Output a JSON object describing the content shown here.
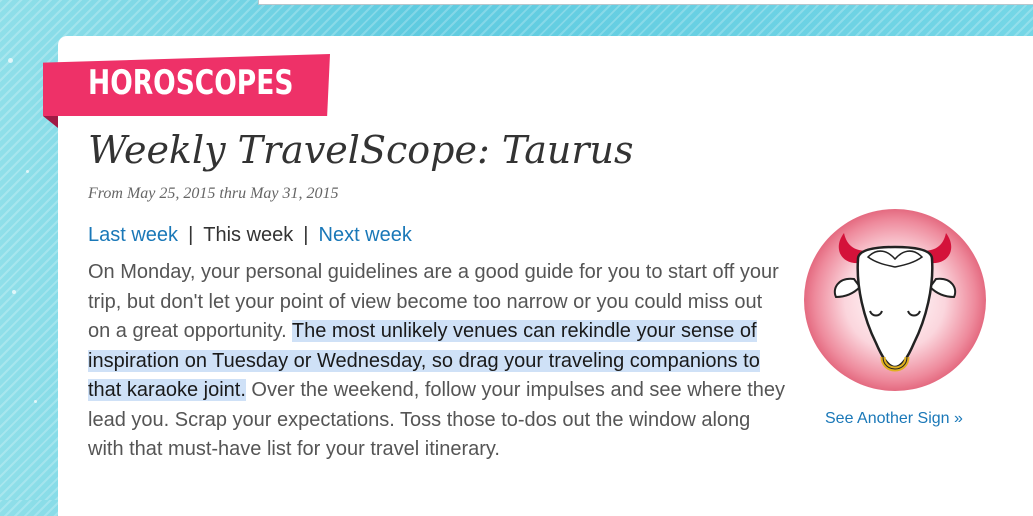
{
  "section": {
    "label": "HOROSCOPES"
  },
  "article": {
    "title": "Weekly TravelScope: Taurus",
    "date_range": "From May 25, 2015 thru May 31, 2015"
  },
  "week_nav": {
    "last_week": "Last week",
    "separator": "|",
    "this_week": "This week",
    "next_week": "Next week"
  },
  "horoscope": {
    "before_highlight": "On Monday, your personal guidelines are a good guide for you to start off your trip, but don't let your point of view become too narrow or you could miss out on a great opportunity. ",
    "highlighted": "The most unlikely venues can rekindle your sense of inspiration on Tuesday or Wednesday, so drag your traveling companions to that karaoke joint.",
    "after_highlight": " Over the weekend, follow your impulses and see where they lead you. Scrap your expectations. Toss those to-dos out the window along with that must-have list for your travel itinerary."
  },
  "sign": {
    "icon": "taurus-bull-icon",
    "link": "See Another Sign »"
  },
  "colors": {
    "ribbon": "#ee3168",
    "link": "#1a78b8",
    "highlight": "#cfe1f7",
    "background": "#6fd3e3"
  }
}
